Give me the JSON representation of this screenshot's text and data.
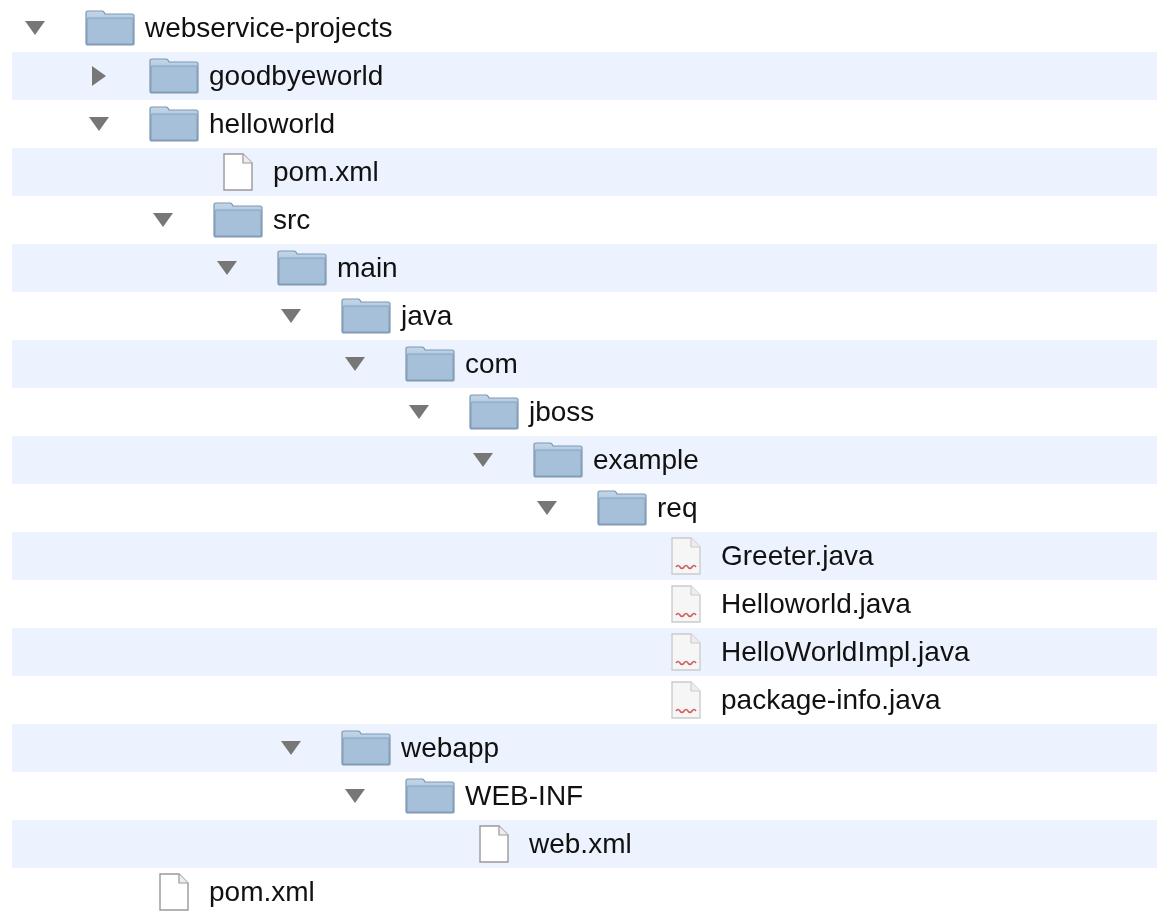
{
  "tree": [
    {
      "name": "webservice-projects",
      "kind": "folder",
      "expanded": true,
      "children": [
        {
          "name": "goodbyeworld",
          "kind": "folder",
          "expanded": false
        },
        {
          "name": "helloworld",
          "kind": "folder",
          "expanded": true,
          "children": [
            {
              "name": "pom.xml",
              "kind": "file"
            },
            {
              "name": "src",
              "kind": "folder",
              "expanded": true,
              "children": [
                {
                  "name": "main",
                  "kind": "folder",
                  "expanded": true,
                  "children": [
                    {
                      "name": "java",
                      "kind": "folder",
                      "expanded": true,
                      "children": [
                        {
                          "name": "com",
                          "kind": "folder",
                          "expanded": true,
                          "children": [
                            {
                              "name": "jboss",
                              "kind": "folder",
                              "expanded": true,
                              "children": [
                                {
                                  "name": "example",
                                  "kind": "folder",
                                  "expanded": true,
                                  "children": [
                                    {
                                      "name": "req",
                                      "kind": "folder",
                                      "expanded": true,
                                      "children": [
                                        {
                                          "name": "Greeter.java",
                                          "kind": "java"
                                        },
                                        {
                                          "name": "Helloworld.java",
                                          "kind": "java"
                                        },
                                        {
                                          "name": "HelloWorldImpl.java",
                                          "kind": "java"
                                        },
                                        {
                                          "name": "package-info.java",
                                          "kind": "java"
                                        }
                                      ]
                                    }
                                  ]
                                }
                              ]
                            }
                          ]
                        }
                      ]
                    },
                    {
                      "name": "webapp",
                      "kind": "folder",
                      "expanded": true,
                      "children": [
                        {
                          "name": "WEB-INF",
                          "kind": "folder",
                          "expanded": true,
                          "children": [
                            {
                              "name": "web.xml",
                              "kind": "file"
                            }
                          ]
                        }
                      ]
                    }
                  ]
                }
              ]
            }
          ]
        },
        {
          "name": "pom.xml",
          "kind": "file"
        }
      ]
    }
  ]
}
